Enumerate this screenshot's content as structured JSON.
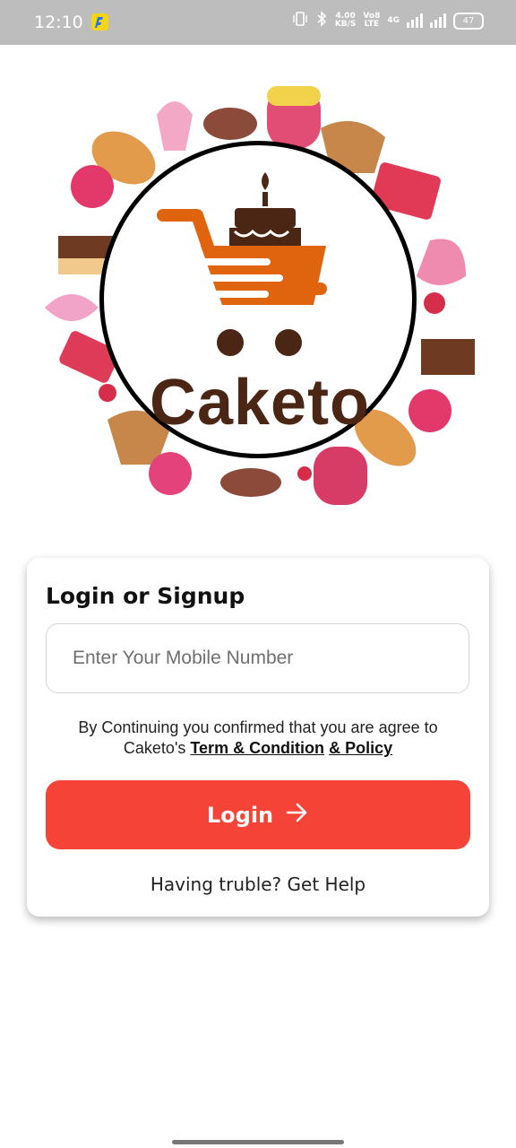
{
  "status_bar": {
    "time": "12:10",
    "speed_value": "4.00",
    "speed_unit": "KB/S",
    "volte_top": "Vo8",
    "volte_bottom": "LTE",
    "network": "4G",
    "battery": "47"
  },
  "brand": {
    "name": "Caketo",
    "accent_color": "#e0640e",
    "dark_color": "#4b2615"
  },
  "login": {
    "title": "Login or Signup",
    "phone_placeholder": "Enter Your Mobile Number",
    "phone_value": "",
    "terms_line1": "By Continuing you confirmed that you are agree to",
    "terms_prefix": "Caketo's ",
    "terms_link": "Term & Condition",
    "policy_link": "& Policy",
    "button_label": "Login",
    "button_color": "#f54337",
    "help_text": "Having truble? Get Help"
  }
}
